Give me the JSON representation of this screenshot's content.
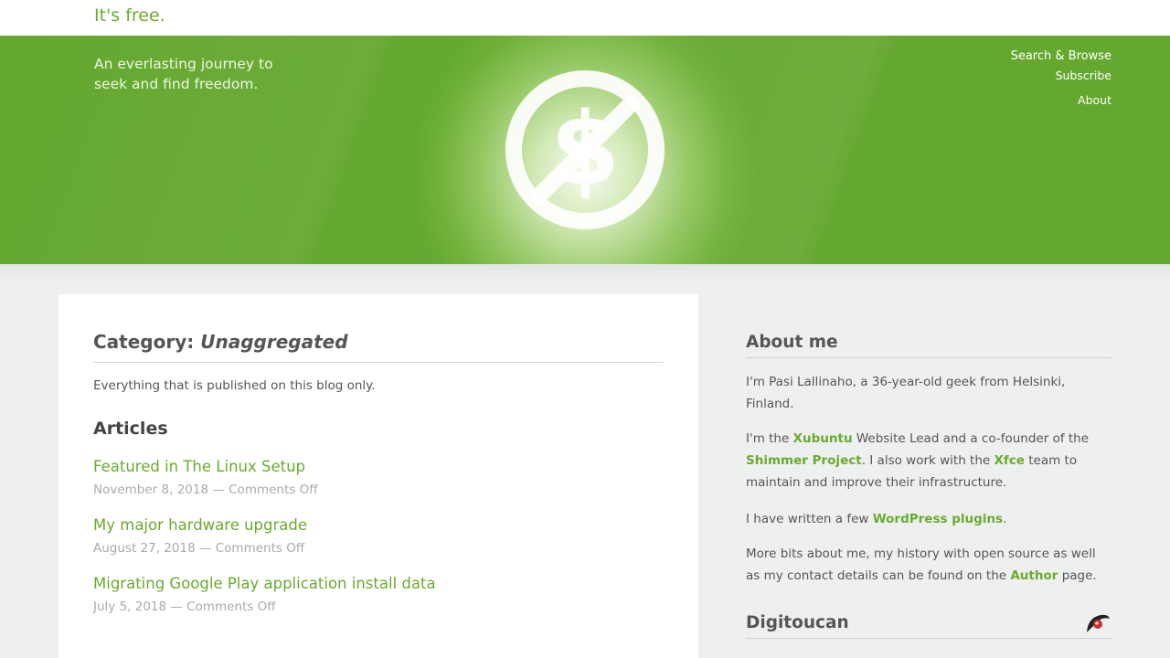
{
  "site": {
    "title": "It's free."
  },
  "hero": {
    "tagline": "An everlasting journey to seek and find freedom.",
    "logo_icon": "no-dollar-icon"
  },
  "nav": [
    "Search & Browse",
    "Subscribe",
    "About"
  ],
  "main": {
    "category_label": "Category:",
    "category_name": "Unaggregated",
    "description": "Everything that is published on this blog only.",
    "articles_heading": "Articles",
    "posts": [
      {
        "title": "Featured in The Linux Setup",
        "meta": "November 8, 2018 — Comments Off"
      },
      {
        "title": "My major hardware upgrade",
        "meta": "August 27, 2018 — Comments Off"
      },
      {
        "title": "Migrating Google Play application install data",
        "meta": "July 5, 2018 — Comments Off"
      }
    ]
  },
  "sidebar": {
    "about_heading": "About me",
    "about_p1": "I'm Pasi Lallinaho, a 36-year-old geek from Helsinki, Finland.",
    "about_p2_a": "I'm the ",
    "about_p2_link1": "Xubuntu",
    "about_p2_b": " Website Lead and a co-founder of the ",
    "about_p2_link2": "Shimmer Project",
    "about_p2_c": ". I also work with the ",
    "about_p2_link3": "Xfce",
    "about_p2_d": " team to maintain and improve their infrastructure.",
    "about_p3_a": "I have written a few ",
    "about_p3_link": "WordPress plugins",
    "about_p3_b": ".",
    "about_p4_a": "More bits about me, my history with open source as well as my contact details can be found on the ",
    "about_p4_link": "Author",
    "about_p4_b": " page.",
    "digitoucan_heading": "Digitoucan",
    "digitoucan_icon": "toucan-icon"
  },
  "colors": {
    "accent": "#6aaa2e",
    "hero_green": "#6db036"
  }
}
